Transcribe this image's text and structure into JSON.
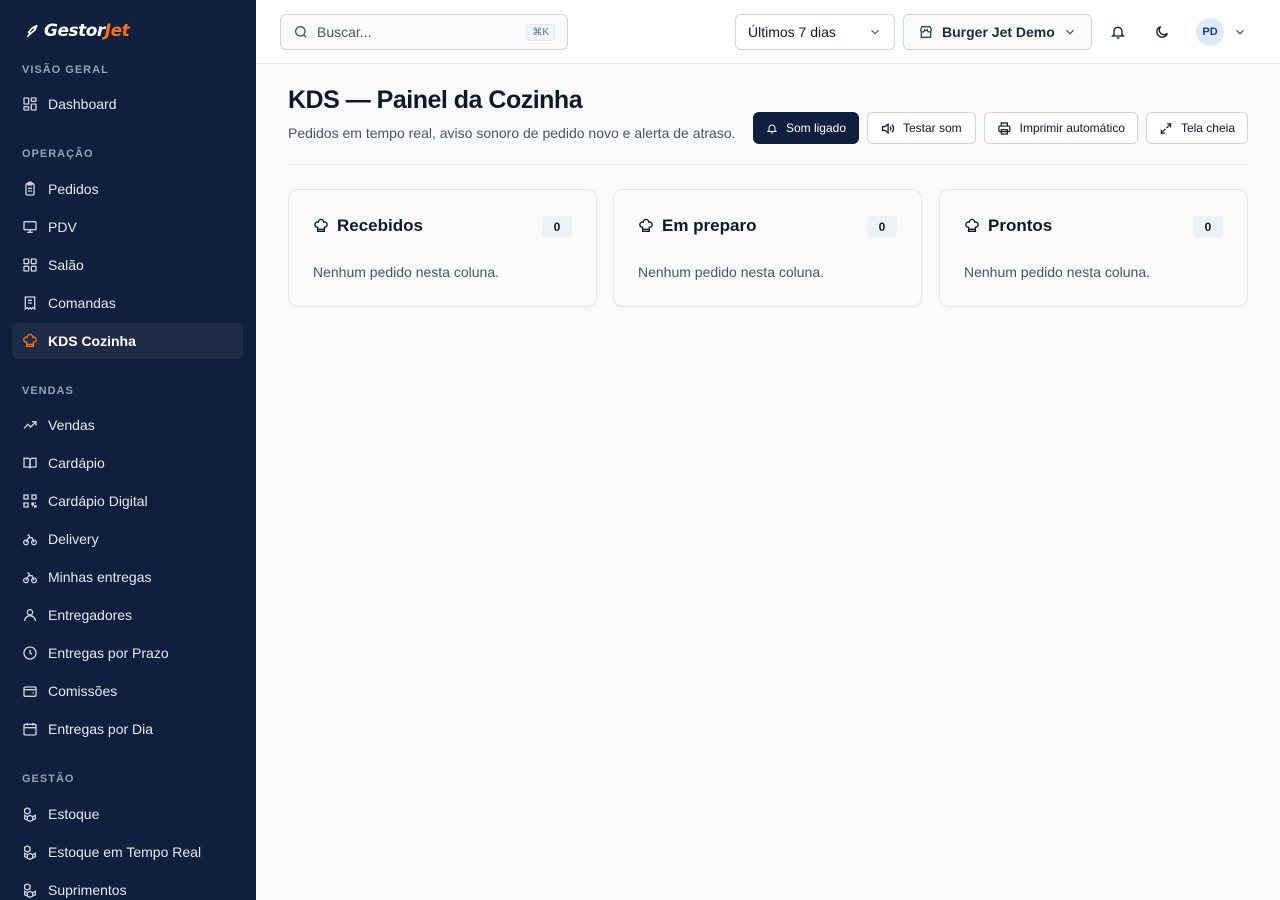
{
  "brand": {
    "name_main": "Gestor",
    "name_accent": "Jet"
  },
  "sidebar": {
    "sections": [
      {
        "title": "VISÃO GERAL"
      },
      {
        "title": "OPERAÇÃO"
      },
      {
        "title": "VENDAS"
      },
      {
        "title": "GESTÃO"
      }
    ],
    "items": [
      {
        "label": "Dashboard",
        "icon": "grid-icon"
      },
      {
        "label": "Pedidos",
        "icon": "clipboard-icon"
      },
      {
        "label": "PDV",
        "icon": "monitor-icon"
      },
      {
        "label": "Salão",
        "icon": "grid-icon"
      },
      {
        "label": "Comandas",
        "icon": "receipt-icon"
      },
      {
        "label": "KDS Cozinha",
        "icon": "chef-hat-icon",
        "active": true
      },
      {
        "label": "Vendas",
        "icon": "trending-up-icon"
      },
      {
        "label": "Cardápio",
        "icon": "book-icon"
      },
      {
        "label": "Cardápio Digital",
        "icon": "qr-code-icon"
      },
      {
        "label": "Delivery",
        "icon": "bike-icon"
      },
      {
        "label": "Minhas entregas",
        "icon": "bike-icon"
      },
      {
        "label": "Entregadores",
        "icon": "user-icon"
      },
      {
        "label": "Entregas por Prazo",
        "icon": "clock-icon"
      },
      {
        "label": "Comissões",
        "icon": "wallet-icon"
      },
      {
        "label": "Entregas por Dia",
        "icon": "calendar-icon"
      },
      {
        "label": "Estoque",
        "icon": "boxes-icon"
      },
      {
        "label": "Estoque em Tempo Real",
        "icon": "boxes-icon"
      },
      {
        "label": "Suprimentos",
        "icon": "boxes-icon"
      }
    ]
  },
  "topbar": {
    "search_placeholder": "Buscar...",
    "search_shortcut": "⌘K",
    "period": "Últimos 7 dias",
    "store": "Burger Jet Demo",
    "avatar_initials": "PD"
  },
  "page": {
    "title": "KDS — Painel da Cozinha",
    "subtitle": "Pedidos em tempo real, aviso sonoro de pedido novo e alerta de atraso.",
    "buttons": {
      "sound": "Som ligado",
      "test_sound": "Testar som",
      "auto_print": "Imprimir automático",
      "fullscreen": "Tela cheia"
    }
  },
  "columns": [
    {
      "title": "Recebidos",
      "count": "0",
      "empty": "Nenhum pedido nesta coluna."
    },
    {
      "title": "Em preparo",
      "count": "0",
      "empty": "Nenhum pedido nesta coluna."
    },
    {
      "title": "Prontos",
      "count": "0",
      "empty": "Nenhum pedido nesta coluna."
    }
  ],
  "colors": {
    "sidebar_bg": "#0f1f3d",
    "accent": "#f97316",
    "primary_button": "#0f1f3d"
  }
}
